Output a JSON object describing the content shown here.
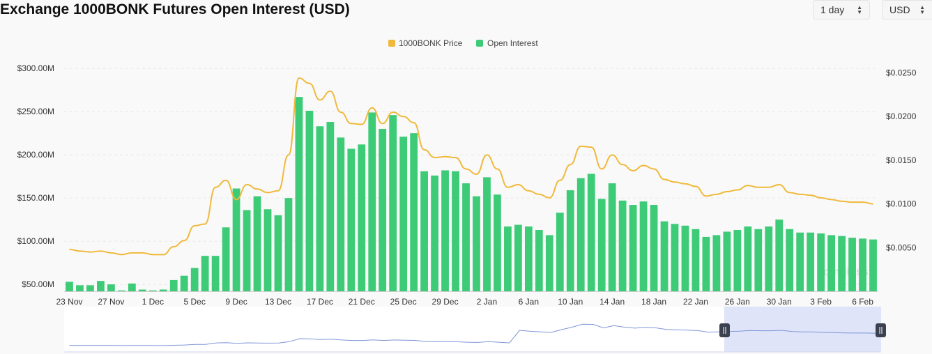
{
  "header": {
    "title": "Exchange 1000BONK Futures Open Interest (USD)",
    "interval": "1 day",
    "currency": "USD"
  },
  "watermark": "coinglass",
  "colors": {
    "price": "#f0b93b",
    "open_interest": "#3ecb78",
    "slider_fill": "#dfe4f8",
    "slider_line": "#7f96d8",
    "grid": "#e7e7e7"
  },
  "chart_data": {
    "type": "bar",
    "title": "Exchange 1000BONK Futures Open Interest (USD)",
    "x_tick_labels": [
      "23 Nov",
      "27 Nov",
      "1 Dec",
      "5 Dec",
      "9 Dec",
      "13 Dec",
      "17 Dec",
      "21 Dec",
      "25 Dec",
      "29 Dec",
      "2 Jan",
      "6 Jan",
      "10 Jan",
      "14 Jan",
      "18 Jan",
      "22 Jan",
      "26 Jan",
      "30 Jan",
      "3 Feb",
      "6 Feb"
    ],
    "y_left": {
      "ticks": [
        50,
        100,
        150,
        200,
        250,
        300
      ],
      "tick_labels": [
        "$50.00M",
        "$100.00M",
        "$150.00M",
        "$200.00M",
        "$250.00M",
        "$300.00M"
      ],
      "range": [
        42,
        305
      ]
    },
    "y_right": {
      "ticks": [
        0.005,
        0.01,
        0.015,
        0.02,
        0.025
      ],
      "tick_labels": [
        "$0.0050",
        "$0.0100",
        "$0.0150",
        "$0.0200",
        "$0.0250"
      ],
      "range": [
        0,
        0.026
      ]
    },
    "legend": {
      "position": "top-center"
    },
    "grid": true,
    "series": [
      {
        "name": "Open Interest",
        "kind": "bar",
        "axis": "left",
        "values": [
          53,
          49,
          49,
          54,
          50,
          43,
          51,
          44,
          43,
          44,
          55,
          60,
          69,
          83,
          83,
          116,
          161,
          136,
          152,
          137,
          130,
          150,
          267,
          251,
          233,
          238,
          220,
          207,
          212,
          249,
          230,
          246,
          221,
          225,
          181,
          176,
          182,
          181,
          167,
          152,
          174,
          154,
          117,
          119,
          117,
          113,
          107,
          133,
          159,
          173,
          178,
          149,
          167,
          147,
          142,
          146,
          142,
          123,
          120,
          118,
          114,
          105,
          107,
          111,
          113,
          117,
          114,
          117,
          125,
          114,
          110,
          110,
          109,
          107,
          106,
          104,
          103,
          102
        ]
      },
      {
        "name": "1000BONK Price",
        "kind": "line",
        "axis": "right",
        "values": [
          0.0048,
          0.0046,
          0.0045,
          0.0046,
          0.0044,
          0.0042,
          0.0044,
          0.0044,
          0.0042,
          0.0042,
          0.0051,
          0.0058,
          0.0075,
          0.0077,
          0.0119,
          0.0127,
          0.0105,
          0.0122,
          0.0117,
          0.0113,
          0.0115,
          0.0156,
          0.0244,
          0.0238,
          0.0219,
          0.0229,
          0.0205,
          0.0192,
          0.0191,
          0.021,
          0.0192,
          0.0205,
          0.02,
          0.0193,
          0.0162,
          0.0153,
          0.0154,
          0.0153,
          0.014,
          0.0134,
          0.0156,
          0.014,
          0.0119,
          0.0122,
          0.0115,
          0.0111,
          0.0107,
          0.0127,
          0.0145,
          0.0166,
          0.0165,
          0.014,
          0.0156,
          0.0145,
          0.0138,
          0.0144,
          0.014,
          0.0128,
          0.0125,
          0.0123,
          0.012,
          0.0109,
          0.0111,
          0.0114,
          0.0116,
          0.0121,
          0.0119,
          0.0119,
          0.0122,
          0.0113,
          0.0111,
          0.011,
          0.0107,
          0.0105,
          0.0103,
          0.0102,
          0.0102,
          0.01
        ]
      }
    ]
  }
}
